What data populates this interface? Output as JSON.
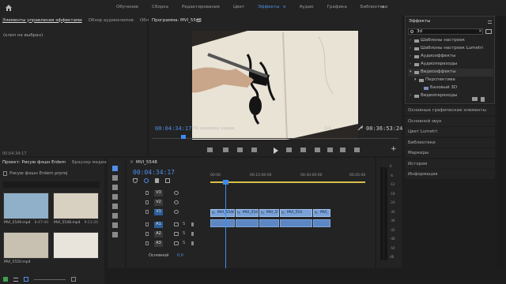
{
  "header": {
    "home_icon": "home-icon",
    "workspaces": [
      "Обучение",
      "Сборка",
      "Редактирование",
      "Цвет",
      "Эффекты",
      "Аудио",
      "Графика",
      "Библиотеки"
    ],
    "active_workspace": "Эффекты",
    "more_label": "»"
  },
  "effect_controls": {
    "tabs": [
      "Элементы управления эффектами",
      "Обзор аудиоклипов",
      "Области Lumetri",
      "Исто"
    ],
    "no_clip": "(клип не выбран)",
    "timecode": "00:04:34:17"
  },
  "program": {
    "title": "Программа: MVI_5548",
    "timecode": "00:04:34:17",
    "fit": "По размеру кадра",
    "ratio": "1/2",
    "duration": "00:36:53:24"
  },
  "project": {
    "tabs": [
      "Проект: Рисую фэшн Erdem",
      "Браузер медиа"
    ],
    "file": "Рисую фэшн Erdem.prproj",
    "items": [
      {
        "name": "MVI_5549.mp4",
        "duration": "8:47:40",
        "tone": "#8fb0c8"
      },
      {
        "name": "MVI_5548.mp4",
        "duration": "9:11:20",
        "tone": "#d8d0c0"
      },
      {
        "name": "MVI_5550.mp4",
        "duration": "",
        "tone": "#c8c0b0"
      },
      {
        "name": "",
        "duration": "",
        "tone": "#e8e4dc"
      }
    ]
  },
  "timeline": {
    "tab": "MVI_5548",
    "timecode": "00:04:34:17",
    "ruler": [
      "00:00",
      "00:15:00:00",
      "00:30:00:00",
      "00:45:00"
    ],
    "video_tracks": [
      "V3",
      "V2",
      "V1"
    ],
    "audio_tracks": [
      "A1",
      "A2",
      "A3"
    ],
    "master_label": "Основной",
    "master_value": "0,0",
    "v1_clips": [
      "MVI_5548.mp4 [V]",
      "MVI_5548.mp",
      "MVI_5548",
      "MVI_554",
      "MVI_"
    ],
    "fx": "fx"
  },
  "meter": {
    "labels": [
      "0",
      "-6",
      "-12",
      "-18",
      "-24",
      "-30",
      "-36",
      "-42",
      "-48",
      "-54",
      "dB"
    ],
    "solo": "S",
    "solo2": "S"
  },
  "effects_panel": {
    "title": "Эффекты",
    "search_value": "3d",
    "tree": [
      {
        "label": "Шаблоны настроек",
        "level": 0,
        "open": false
      },
      {
        "label": "Шаблоны настроек Lumetri",
        "level": 0,
        "open": false
      },
      {
        "label": "Аудиоэффекты",
        "level": 0,
        "open": false
      },
      {
        "label": "Аудиопереходы",
        "level": 0,
        "open": false
      },
      {
        "label": "Видеоэффекты",
        "level": 0,
        "open": true
      },
      {
        "label": "Перспектива",
        "level": 1,
        "open": true
      },
      {
        "label": "Базовый 3D",
        "level": 2,
        "open": false
      },
      {
        "label": "Видеопереходы",
        "level": 0,
        "open": false
      }
    ],
    "panels": [
      "Основные графические элементы",
      "Основной звук",
      "Цвет Lumetri",
      "Библиотеки",
      "Маркеры",
      "История",
      "Информация"
    ]
  },
  "colors": {
    "accent": "#4f8fe8",
    "clip_video": "#7aa2d8",
    "clip_audio": "#5c86c4",
    "track_v1": "#2d5f9a",
    "playhead": "#3c8cf0",
    "workarea": "#d6c04a"
  }
}
